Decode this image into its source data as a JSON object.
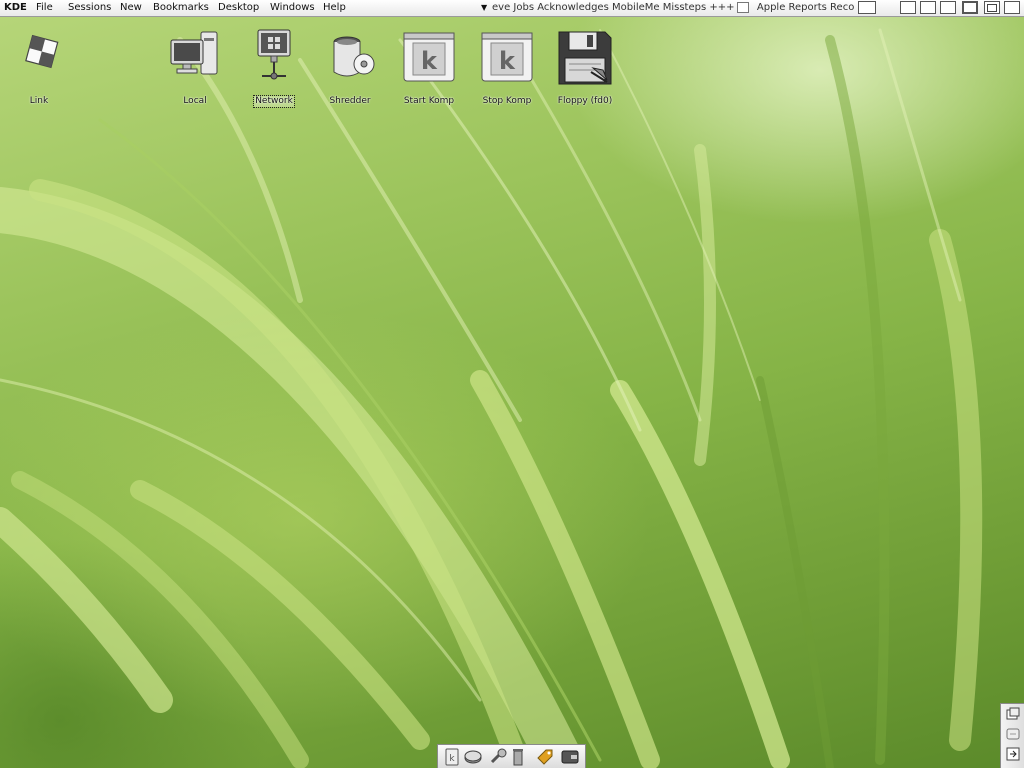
{
  "menubar": {
    "items": [
      "KDE",
      "File",
      "Sessions",
      "New",
      "Bookmarks",
      "Desktop",
      "Windows",
      "Help"
    ],
    "ticker_arrow": "▼",
    "ticker_text": "eve Jobs Acknowledges MobileMe Missteps +++",
    "ticker_text_2": "Apple Reports Reco"
  },
  "desktop": {
    "icons": [
      {
        "label": "Link",
        "icon": "link-icon"
      },
      {
        "label": "Local",
        "icon": "computer-icon"
      },
      {
        "label": "Network",
        "icon": "network-icon"
      },
      {
        "label": "Shredder",
        "icon": "shredder-icon"
      },
      {
        "label": "Start Komp",
        "icon": "komp-icon"
      },
      {
        "label": "Stop Komp",
        "icon": "komp-icon"
      },
      {
        "label": "Floppy (fd0)",
        "icon": "floppy-icon"
      }
    ]
  },
  "dock": {
    "items": [
      "kde-menu-icon",
      "disk-icon",
      "tools-icon",
      "trash-icon",
      "tag-icon",
      "wallet-icon"
    ]
  },
  "mini_panel": {
    "items": [
      "window-list-icon",
      "restore-icon",
      "exit-icon"
    ]
  },
  "colors": {
    "wallpaper": "#86b447",
    "menubar": "#f0f0f0"
  }
}
